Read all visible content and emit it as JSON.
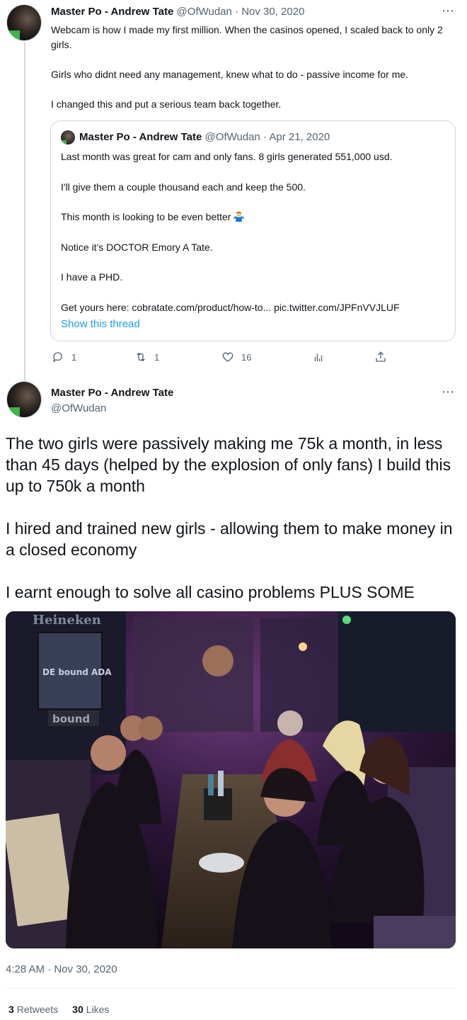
{
  "tweet": {
    "author_name": "Master Po - Andrew Tate",
    "author_handle": "@OfWudan",
    "date": "Nov 30, 2020",
    "meta": "@OfWudan · Nov 30, 2020",
    "paragraphs": [
      "Webcam is how I made my first million. When the casinos opened, I scaled back to only 2 girls.",
      "Girls who didnt need any management, knew what to do  - passive income for me.",
      "I changed this and put a serious team back together."
    ],
    "more_icon": "⋯"
  },
  "quoted": {
    "author_name": "Master Po - Andrew Tate",
    "meta": "@OfWudan · Apr 21, 2020",
    "lines": [
      "Last month was great for cam and only fans. 8 girls generated 551,000 usd.",
      "I'll give them a couple thousand each and keep the 500.",
      "This month is looking to be even better",
      "Notice it's DOCTOR Emory A Tate.",
      "I have a PHD.",
      "Get yours here: cobratate.com/product/how-to... pic.twitter.com/JPFnVVJLUF"
    ],
    "emoji_icon": "man-shrugging-emoji",
    "show_thread": "Show this thread"
  },
  "actions": {
    "reply_count": "1",
    "retweet_count": "1",
    "like_count": "16"
  },
  "reply": {
    "author_name": "Master Po - Andrew Tate",
    "author_handle": "@OfWudan",
    "paragraphs": [
      "The two girls were passively making me 75k a month, in less than 45 days (helped by the explosion of only fans) I build this up to 750k a month",
      "I hired and trained new girls - allowing them to make money in a closed economy",
      "I earnt enough to solve all casino problems PLUS SOME"
    ],
    "photo_signs": [
      "Heineken",
      "DE bound ADA",
      "bound"
    ],
    "timestamp": "4:28 AM · Nov 30, 2020",
    "retweets_count": "3",
    "retweets_label": "Retweets",
    "likes_count": "30",
    "likes_label": "Likes"
  },
  "colors": {
    "accent": "#1d9bf0",
    "secondary_text": "#536471",
    "border": "#cfd9de"
  }
}
